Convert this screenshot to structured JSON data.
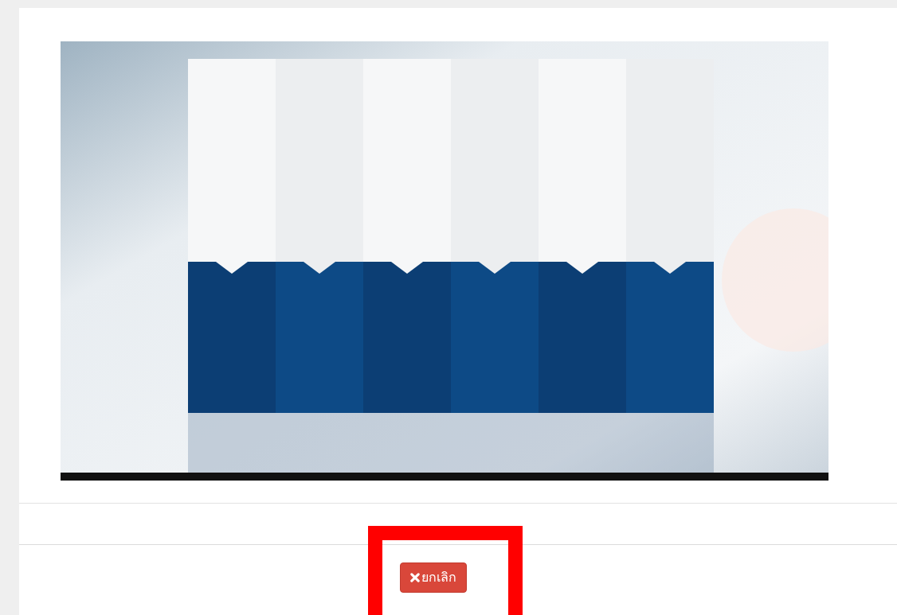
{
  "footer": {
    "cancel_button": {
      "label": "ยกเลิก"
    }
  }
}
